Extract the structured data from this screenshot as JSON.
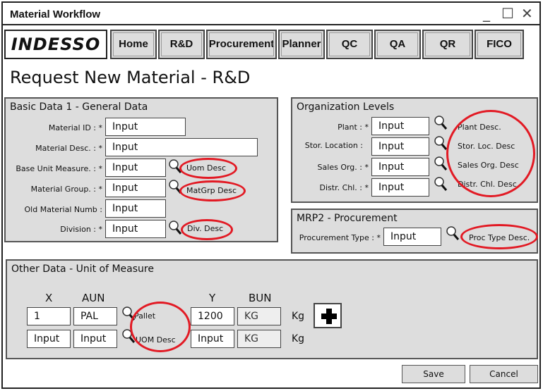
{
  "window": {
    "title": "Material Workflow",
    "minimize": "_",
    "maximize": "☐",
    "close": "✕"
  },
  "logo": "INDESSO",
  "nav": [
    "Home",
    "R&D",
    "Procurement",
    "Planner",
    "QC",
    "QA",
    "QR",
    "FICO"
  ],
  "page_title": "Request New Material - R&D",
  "basic_data": {
    "title": "Basic Data 1 - General Data",
    "material_id": {
      "label": "Material ID : *",
      "value": "Input"
    },
    "material_desc": {
      "label": "Material Desc. : *",
      "value": "Input"
    },
    "base_unit": {
      "label": "Base Unit Measure. : *",
      "value": "Input",
      "desc": "Uom Desc"
    },
    "material_group": {
      "label": "Material Group. : *",
      "value": "Input",
      "desc": "MatGrp Desc"
    },
    "old_material": {
      "label": "Old Material Numb :",
      "value": "Input"
    },
    "division": {
      "label": "Division : *",
      "value": "Input",
      "desc": "Div. Desc"
    }
  },
  "org_levels": {
    "title": "Organization Levels",
    "plant": {
      "label": "Plant : *",
      "value": "Input",
      "desc": "Plant Desc."
    },
    "stor_location": {
      "label": "Stor. Location :",
      "value": "Input",
      "desc": "Stor. Loc. Desc"
    },
    "sales_org": {
      "label": "Sales Org. : *",
      "value": "Input",
      "desc": "Sales Org. Desc"
    },
    "distr_chl": {
      "label": "Distr. Chl. : *",
      "value": "Input",
      "desc": "Distr. Chl. Desc"
    }
  },
  "mrp2": {
    "title": "MRP2 - Procurement",
    "procurement_type": {
      "label": "Procurement Type : *",
      "value": "Input",
      "desc": "Proc Type Desc."
    }
  },
  "other_data": {
    "title": "Other Data - Unit of Measure",
    "headers": {
      "x": "X",
      "aun": "AUN",
      "y": "Y",
      "bun": "BUN"
    },
    "rows": [
      {
        "x": "1",
        "aun": "PAL",
        "aun_desc": "Pallet",
        "y": "1200",
        "bun": "KG",
        "unit": "Kg"
      },
      {
        "x": "Input",
        "aun": "Input",
        "aun_desc": "UOM Desc",
        "y": "Input",
        "bun": "KG",
        "unit": "Kg"
      }
    ]
  },
  "buttons": {
    "save": "Save",
    "cancel": "Cancel"
  },
  "colors": {
    "annotation": "#e21a24",
    "panel": "#dddddd"
  },
  "icons": [
    "magnifier-icon",
    "plus-icon",
    "minimize-icon",
    "maximize-icon",
    "close-icon"
  ]
}
